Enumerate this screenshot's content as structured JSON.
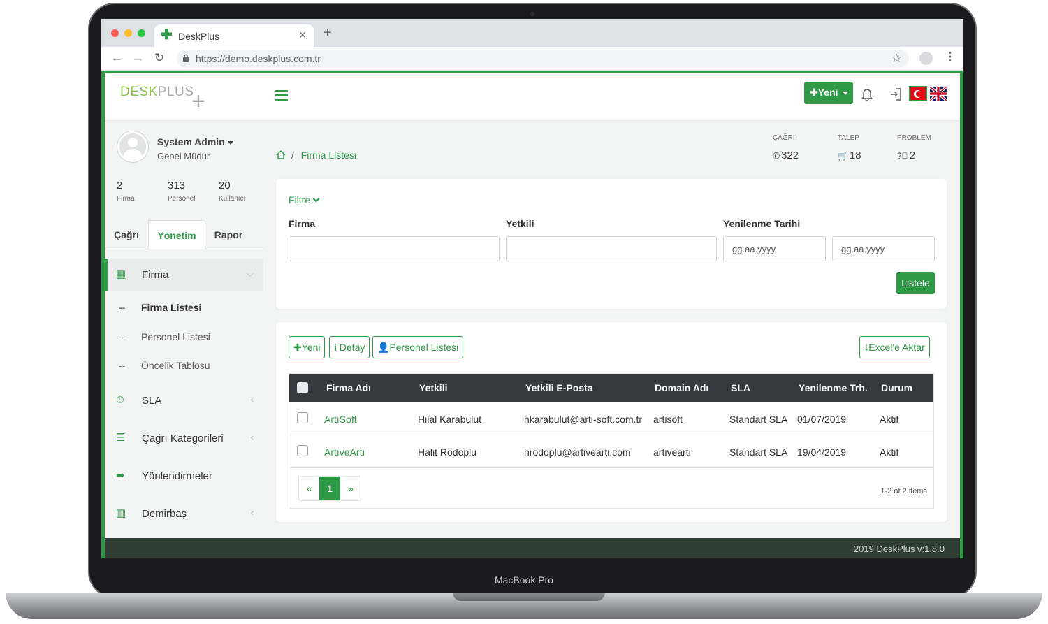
{
  "device": {
    "label": "MacBook Pro"
  },
  "browser": {
    "tab_title": "DeskPlus",
    "url": "https://demo.deskplus.com.tr"
  },
  "header": {
    "logo_desk": "DESK",
    "logo_plus": "PLUS",
    "new_button": "Yeni"
  },
  "user": {
    "name": "System Admin",
    "role": "Genel Müdür",
    "stats": [
      {
        "value": "2",
        "label": "Firma"
      },
      {
        "value": "313",
        "label": "Personel"
      },
      {
        "value": "20",
        "label": "Kullanıcı"
      }
    ]
  },
  "sidebar": {
    "tabs": [
      "Çağrı",
      "Yönetim",
      "Rapor"
    ],
    "active_tab": "Yönetim",
    "menu": [
      {
        "label": "Firma",
        "icon": "building-icon"
      },
      {
        "label": "SLA",
        "icon": "stopwatch-icon"
      },
      {
        "label": "Çağrı Kategorileri",
        "icon": "list-icon"
      },
      {
        "label": "Yönlendirmeler",
        "icon": "share-icon"
      },
      {
        "label": "Demirbaş",
        "icon": "barcode-icon"
      }
    ],
    "submenu": [
      "Firma Listesi",
      "Personel Listesi",
      "Öncelik Tablosu"
    ],
    "submenu_dash": "--"
  },
  "breadcrumb": {
    "separator": "/",
    "current": "Firma Listesi"
  },
  "counters": [
    {
      "label": "ÇAĞRI",
      "value": "322",
      "icon": "phone-icon"
    },
    {
      "label": "TALEP",
      "value": "18",
      "icon": "cart-icon"
    },
    {
      "label": "PROBLEM",
      "value": "2",
      "icon": "question-icon"
    }
  ],
  "filter": {
    "title": "Filtre",
    "fields": {
      "firma": "Firma",
      "yetkili": "Yetkili",
      "tarih": "Yenilenme Tarihi"
    },
    "date_placeholder": "gg.aa.yyyy",
    "submit": "Listele"
  },
  "toolbar": {
    "new": "Yeni",
    "detail": "Detay",
    "staff": "Personel Listesi",
    "export": "Excel'e Aktar"
  },
  "table": {
    "columns": [
      "Firma Adı",
      "Yetkili",
      "Yetkili E-Posta",
      "Domain Adı",
      "SLA",
      "Yenilenme Trh.",
      "Durum"
    ],
    "rows": [
      {
        "firma": "ArtıSoft",
        "yetkili": "Hilal Karabulut",
        "email": "hkarabulut@arti-soft.com.tr",
        "domain": "artisoft",
        "sla": "Standart SLA",
        "date": "01/07/2019",
        "status": "Aktif"
      },
      {
        "firma": "ArtıveArtı",
        "yetkili": "Halit Rodoplu",
        "email": "hrodoplu@artivearti.com",
        "domain": "artivearti",
        "sla": "Standart SLA",
        "date": "19/04/2019",
        "status": "Aktif"
      }
    ],
    "pager": {
      "prev": "«",
      "page": "1",
      "next": "»"
    },
    "items_info": "1-2 of 2 items"
  },
  "footer": {
    "text": "2019 DeskPlus v:1.8.0"
  },
  "colors": {
    "brand": "#2e9a46",
    "header_dark": "#343a40"
  }
}
